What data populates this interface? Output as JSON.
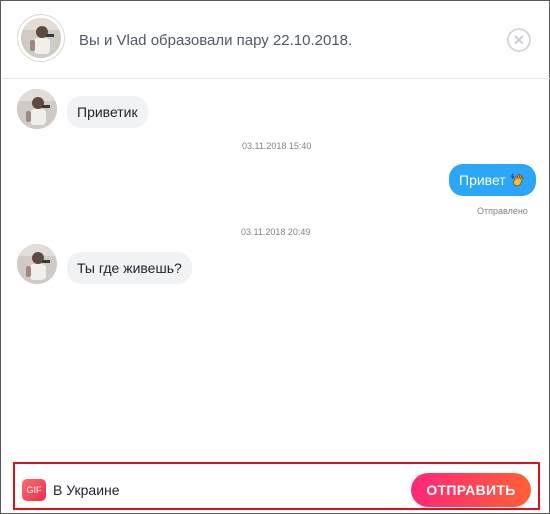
{
  "header": {
    "match_text": "Вы и Vlad образовали пару 22.10.2018.",
    "close_icon": "close-icon"
  },
  "messages": [
    {
      "direction": "in",
      "text": "Приветик"
    },
    {
      "timestamp": "03.11.2018 15:40"
    },
    {
      "direction": "out",
      "text": "Привет",
      "emoji": "waving-hand-icon",
      "status": "Отправлено"
    },
    {
      "timestamp": "03.11.2018 20:49"
    },
    {
      "direction": "in",
      "text": "Ты где живешь?"
    }
  ],
  "composer": {
    "gif_label": "GIF",
    "input_value": "В Украине",
    "send_label": "ОТПРАВИТЬ"
  },
  "colors": {
    "outgoing_bubble": "#2ba6f8",
    "incoming_bubble": "#f0f2f4",
    "send_gradient_start": "#fd267a",
    "send_gradient_end": "#ff6036",
    "highlight_border": "#e0111b"
  }
}
